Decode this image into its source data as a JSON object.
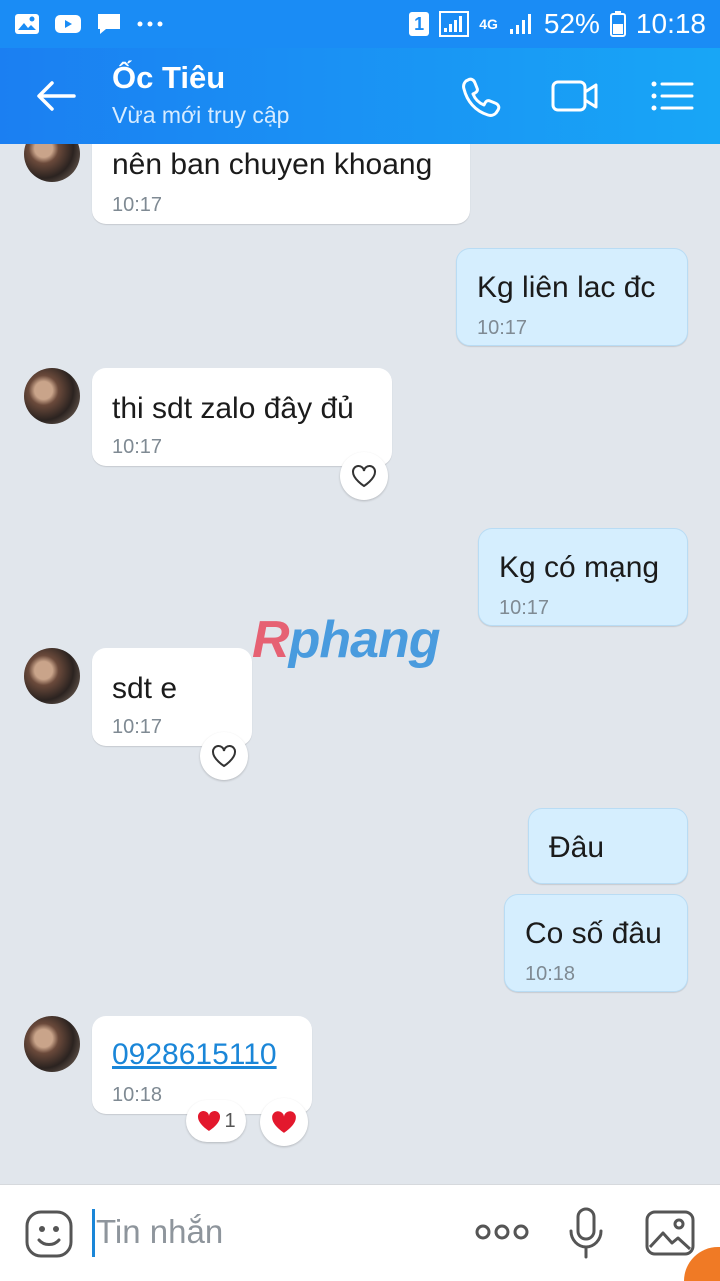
{
  "status_bar": {
    "sim_slot": "1",
    "network": "4G",
    "battery": "52%",
    "time": "10:18"
  },
  "header": {
    "title": "Ốc Tiêu",
    "subtitle": "Vừa mới truy cập",
    "icons": [
      "back-arrow-icon",
      "phone-icon",
      "video-call-icon",
      "menu-list-icon"
    ]
  },
  "messages": [
    {
      "side": "in",
      "text": "nên ban chuyen khoang",
      "time": "10:17"
    },
    {
      "side": "out",
      "text": "Kg liên lac đc",
      "time": "10:17"
    },
    {
      "side": "in",
      "text": "thi sdt zalo đây đủ",
      "time": "10:17",
      "reaction": "heart-outline"
    },
    {
      "side": "out",
      "text": "Kg có mạng",
      "time": "10:17"
    },
    {
      "side": "in",
      "text": "sdt e",
      "time": "10:17",
      "reaction": "heart-outline"
    },
    {
      "side": "out",
      "text": "Đâu",
      "time": ""
    },
    {
      "side": "out",
      "text": "Co số đâu",
      "time": "10:18"
    },
    {
      "side": "in",
      "text": "0928615110",
      "time": "10:18",
      "reaction_count": "1"
    }
  ],
  "watermark": {
    "first": "R",
    "rest": "phang"
  },
  "input": {
    "placeholder": "Tin nhắn",
    "icons": [
      "emoji-icon",
      "more-dots-icon",
      "microphone-icon",
      "image-icon"
    ]
  },
  "colors": {
    "header": "#1a8cf5",
    "incoming_bubble": "#ffffff",
    "outgoing_bubble": "#d5eefe",
    "background": "#e1e6ec",
    "link": "#1a86d8"
  }
}
